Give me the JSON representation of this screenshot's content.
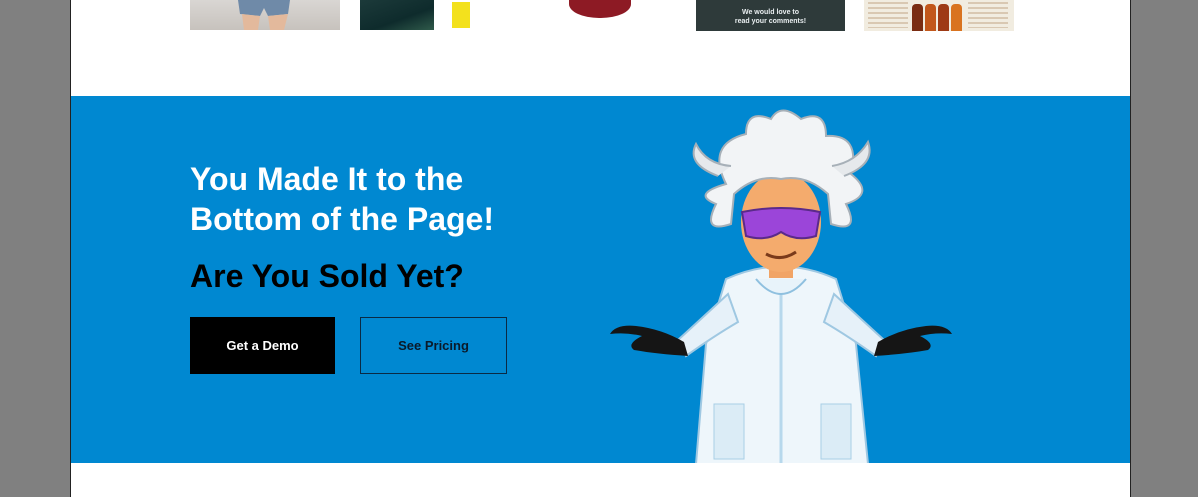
{
  "thumbnails": {
    "comment_card": {
      "line1": "We would love to",
      "line2": "read your comments!"
    }
  },
  "hero": {
    "headline": "You Made It to the Bottom of the Page!",
    "subheadline": "Are You Sold Yet?",
    "primary_button": "Get a Demo",
    "secondary_button": "See Pricing"
  },
  "colors": {
    "hero_bg": "#0088d1",
    "headline": "#ffffff",
    "subheadline": "#000000",
    "primary_button_bg": "#000000"
  },
  "icons": {
    "mascot": "scientist-mascot-illustration"
  }
}
